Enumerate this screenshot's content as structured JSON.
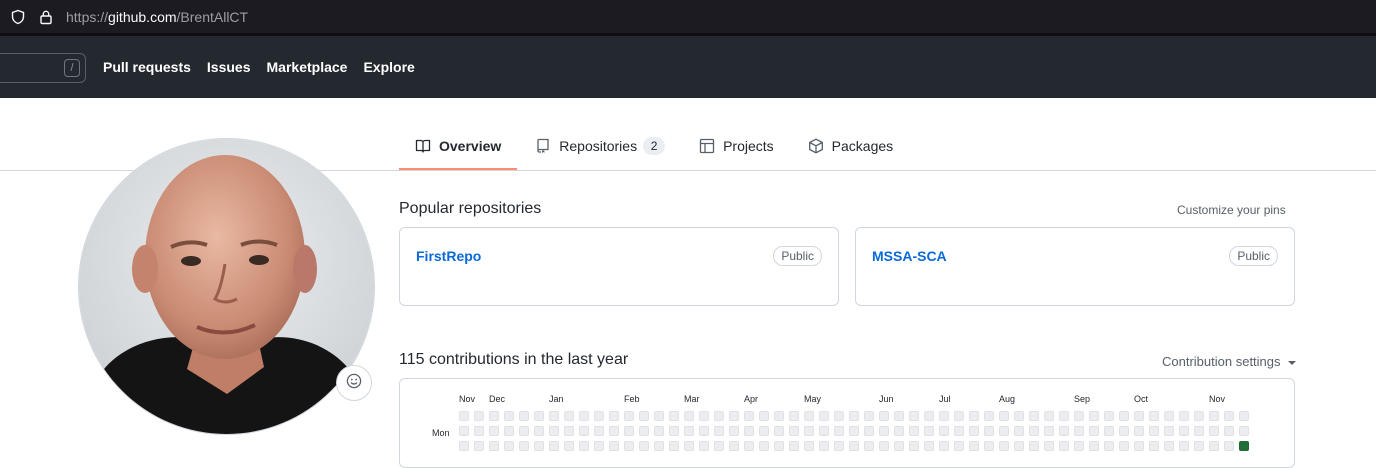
{
  "browser": {
    "url_scheme": "https://",
    "url_host": "github.com",
    "url_path": "/BrentAllCT"
  },
  "header": {
    "search_shortcut": "/",
    "nav": [
      "Pull requests",
      "Issues",
      "Marketplace",
      "Explore"
    ]
  },
  "tabs": [
    {
      "label": "Overview",
      "icon": "book-icon",
      "active": true
    },
    {
      "label": "Repositories",
      "icon": "repo-icon",
      "count": "2"
    },
    {
      "label": "Projects",
      "icon": "table-icon"
    },
    {
      "label": "Packages",
      "icon": "package-icon"
    }
  ],
  "avatar": {
    "status_icon": "smiley-icon"
  },
  "popular": {
    "title": "Popular repositories",
    "customize": "Customize your pins",
    "repos": [
      {
        "name": "FirstRepo",
        "visibility": "Public"
      },
      {
        "name": "MSSA-SCA",
        "visibility": "Public"
      }
    ]
  },
  "contributions": {
    "title": "115 contributions in the last year",
    "settings": "Contribution settings",
    "months": [
      "Nov",
      "Dec",
      "Jan",
      "Feb",
      "Mar",
      "Apr",
      "May",
      "Jun",
      "Jul",
      "Aug",
      "Sep",
      "Oct",
      "Nov"
    ],
    "day_label": "Mon",
    "colors": {
      "empty": "#ebedf0",
      "active": "#216e39"
    }
  }
}
